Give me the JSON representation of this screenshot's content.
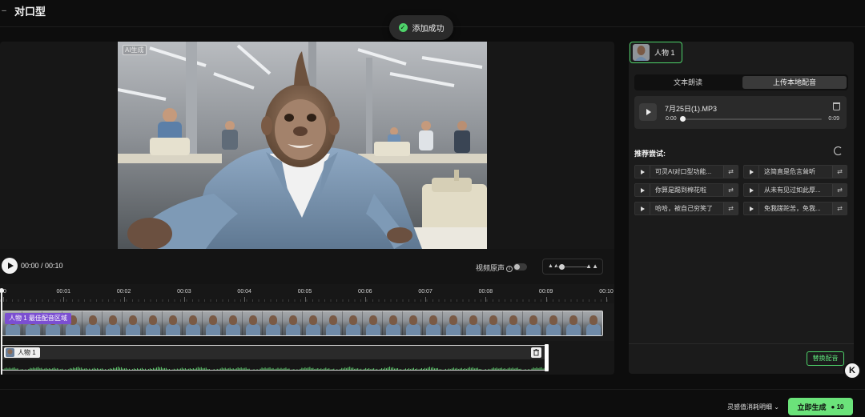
{
  "header": {
    "title": "对口型",
    "back_icon": "arrow-left-icon"
  },
  "toast": {
    "text": "添加成功",
    "icon": "check-circle-icon",
    "color": "#4ed36a"
  },
  "player": {
    "ai_badge": "AI生成",
    "time": "00:00 / 00:10",
    "original_audio_label": "视频原声",
    "original_audio_on": false
  },
  "timeline": {
    "ticks": [
      "00",
      "00:01",
      "00:02",
      "00:03",
      "00:04",
      "00:05",
      "00:06",
      "00:07",
      "00:08",
      "00:09",
      "00:10"
    ],
    "sync_label": "人物 1 最佳配音区域",
    "audio_chip": "人物 1"
  },
  "right_panel": {
    "character": "人物 1",
    "tabs": [
      {
        "label": "文本朗读",
        "active": false
      },
      {
        "label": "上传本地配音",
        "active": true
      }
    ],
    "audio_card": {
      "file": "7月25日(1).MP3",
      "current": "0:00",
      "duration": "0:09",
      "progress": 0
    },
    "recommend_title": "推荐尝试:",
    "recommendations": [
      "可灵AI对口型功能...",
      "这简直是危言耸听",
      "你算是踢到棉花啦",
      "从未有见过如此厚...",
      "哈哈，被自己穷笑了",
      "免我蹉跎苦，免我..."
    ],
    "replace_button": "替换配音"
  },
  "footer": {
    "cost_label": "灵感值消耗明细",
    "generate_label": "立即生成",
    "cost_value": "10"
  },
  "colors": {
    "accent": "#6be37a",
    "sync_purple": "#7b4fd1"
  }
}
